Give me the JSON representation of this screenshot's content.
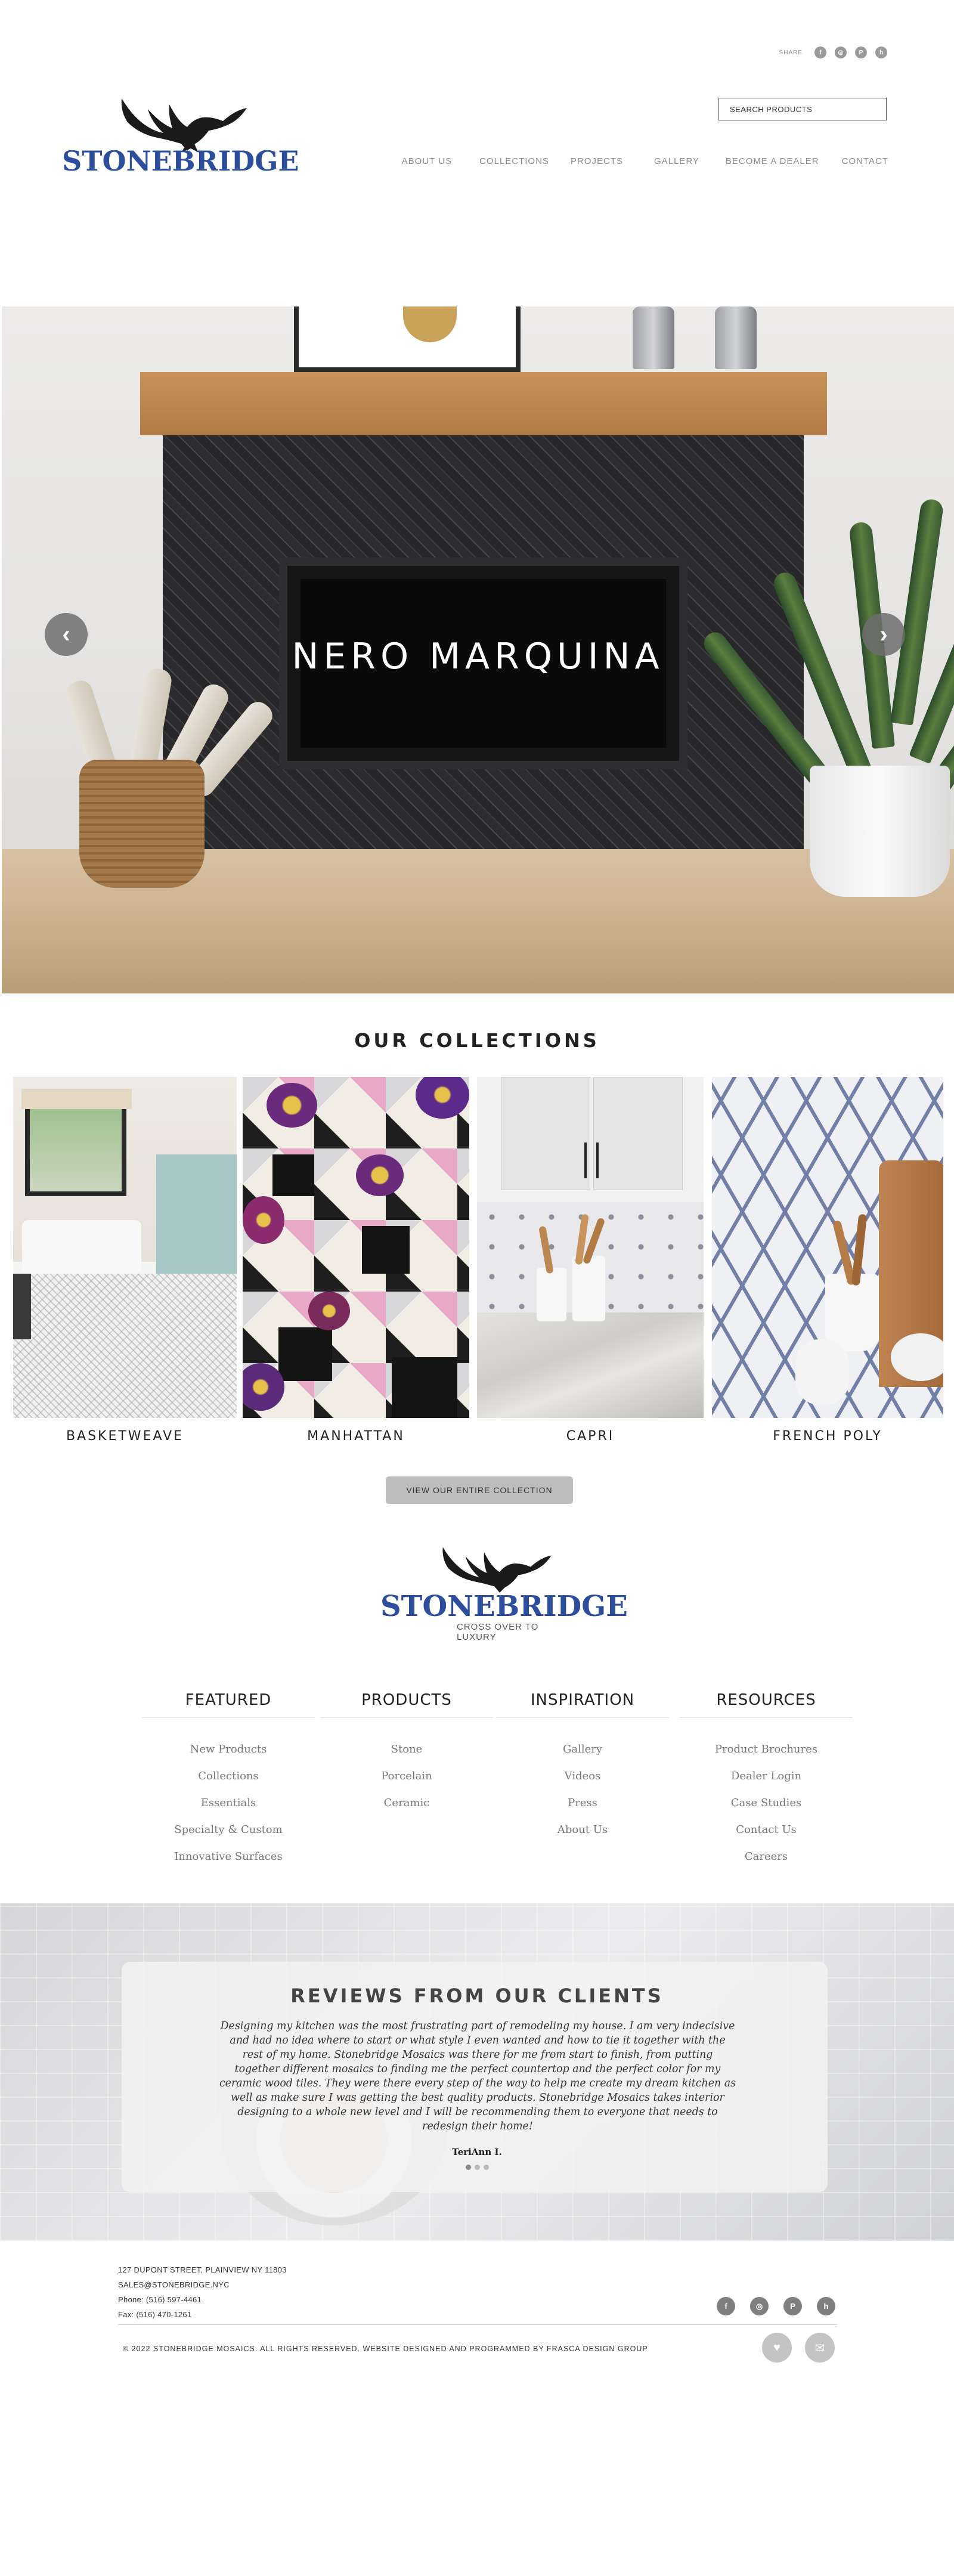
{
  "header": {
    "share_label": "SHARE",
    "share_icons": [
      "facebook-icon",
      "instagram-icon",
      "pinterest-icon",
      "houzz-icon"
    ],
    "search_placeholder": "SEARCH PRODUCTS",
    "logo_text": "STONEBRIDGE",
    "nav": [
      "ABOUT US",
      "COLLECTIONS",
      "PROJECTS",
      "GALLERY",
      "BECOME A DEALER",
      "CONTACT"
    ]
  },
  "hero": {
    "title": "NERO MARQUINA",
    "prev_glyph": "‹",
    "next_glyph": "›"
  },
  "collections": {
    "heading": "OUR COLLECTIONS",
    "items": [
      "BASKETWEAVE",
      "MANHATTAN",
      "CAPRI",
      "FRENCH POLY"
    ],
    "button_label": "VIEW OUR ENTIRE COLLECTION"
  },
  "footer_logo": {
    "text": "STONEBRIDGE",
    "tagline": "CROSS OVER TO LUXURY"
  },
  "link_columns": [
    {
      "heading": "FEATURED",
      "links": [
        "New Products",
        "Collections",
        "Essentials",
        "Specialty & Custom",
        "Innovative Surfaces"
      ]
    },
    {
      "heading": "PRODUCTS",
      "links": [
        "Stone",
        "Porcelain",
        "Ceramic"
      ]
    },
    {
      "heading": "INSPIRATION",
      "links": [
        "Gallery",
        "Videos",
        "Press",
        "About Us"
      ]
    },
    {
      "heading": "RESOURCES",
      "links": [
        "Product Brochures",
        "Dealer Login",
        "Case Studies",
        "Contact Us",
        "Careers"
      ]
    }
  ],
  "reviews": {
    "heading": "REVIEWS FROM OUR CLIENTS",
    "text": "Designing my kitchen was the most frustrating part of remodeling my house. I am very indecisive and had no idea where to start or what style I even wanted and how to tie it together with the rest of my home. Stonebridge Mosaics was there for me from start to finish, from putting together different mosaics to finding me the perfect countertop and the perfect color for my ceramic wood tiles. They were there every step of the way to help me create my dream kitchen as well as make sure I was getting the best quality products. Stonebridge Mosaics takes interior designing to a whole new level and I will be recommending them to everyone that needs to redesign their home!",
    "author": "TeriAnn I."
  },
  "contact": {
    "address": "127 DUPONT STREET, PLAINVIEW NY 11803",
    "email": "SALES@STONEBRIDGE.NYC",
    "phone": "Phone: (516) 597-4461",
    "fax": "Fax: (516) 470-1261"
  },
  "copyright": "© 2022 STONEBRIDGE MOSAICS. ALL RIGHTS RESERVED. WEBSITE DESIGNED AND PROGRAMMED BY FRASCA DESIGN GROUP",
  "colors": {
    "brand_blue": "#2d4e9c",
    "nav_gray": "#8a8a8a",
    "button_gray": "#bdbdbd"
  }
}
